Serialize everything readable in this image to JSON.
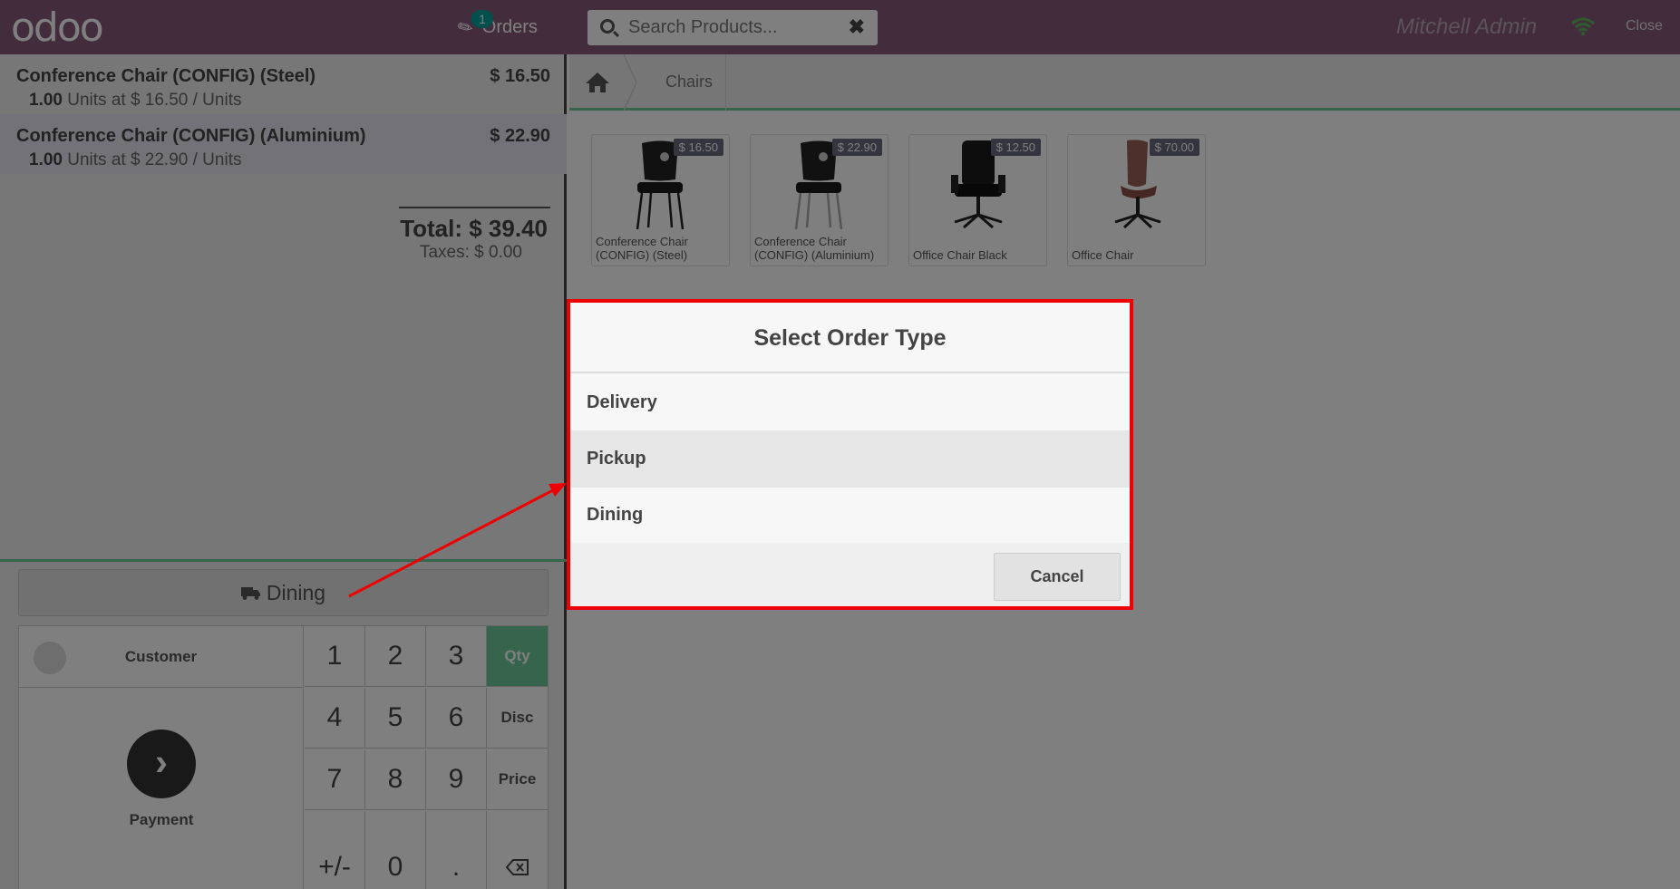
{
  "header": {
    "logo": "odoo",
    "orders_label": "Orders",
    "orders_badge": "1",
    "search_placeholder": "Search Products...",
    "user_name": "Mitchell Admin",
    "close_label": "Close"
  },
  "order": {
    "lines": [
      {
        "name": "Conference Chair (CONFIG) (Steel)",
        "price": "$ 16.50",
        "qty": "1.00",
        "info": " Units at $ 16.50 / Units"
      },
      {
        "name": "Conference Chair (CONFIG) (Aluminium)",
        "price": "$ 22.90",
        "qty": "1.00",
        "info": " Units at $ 22.90 / Units"
      }
    ],
    "total": "Total: $ 39.40",
    "taxes": "Taxes: $ 0.00"
  },
  "controls": {
    "order_type_label": "Dining",
    "customer_label": "Customer",
    "payment_label": "Payment",
    "keys": [
      "1",
      "2",
      "3",
      "4",
      "5",
      "6",
      "7",
      "8",
      "9",
      "+/-",
      "0",
      "."
    ],
    "modes": {
      "qty": "Qty",
      "disc": "Disc",
      "price": "Price"
    }
  },
  "products": {
    "breadcrumb": "Chairs",
    "items": [
      {
        "name": "Conference Chair (CONFIG) (Steel)",
        "price": "$ 16.50"
      },
      {
        "name": "Conference Chair (CONFIG) (Aluminium)",
        "price": "$ 22.90"
      },
      {
        "name": "Office Chair Black",
        "price": "$ 12.50"
      },
      {
        "name": "Office Chair",
        "price": "$ 70.00"
      }
    ]
  },
  "modal": {
    "title": "Select Order Type",
    "options": [
      "Delivery",
      "Pickup",
      "Dining"
    ],
    "cancel_label": "Cancel"
  },
  "colors": {
    "header_bg": "#875a7b",
    "accent_green": "#6ec89b",
    "highlight_border": "#e00000"
  }
}
